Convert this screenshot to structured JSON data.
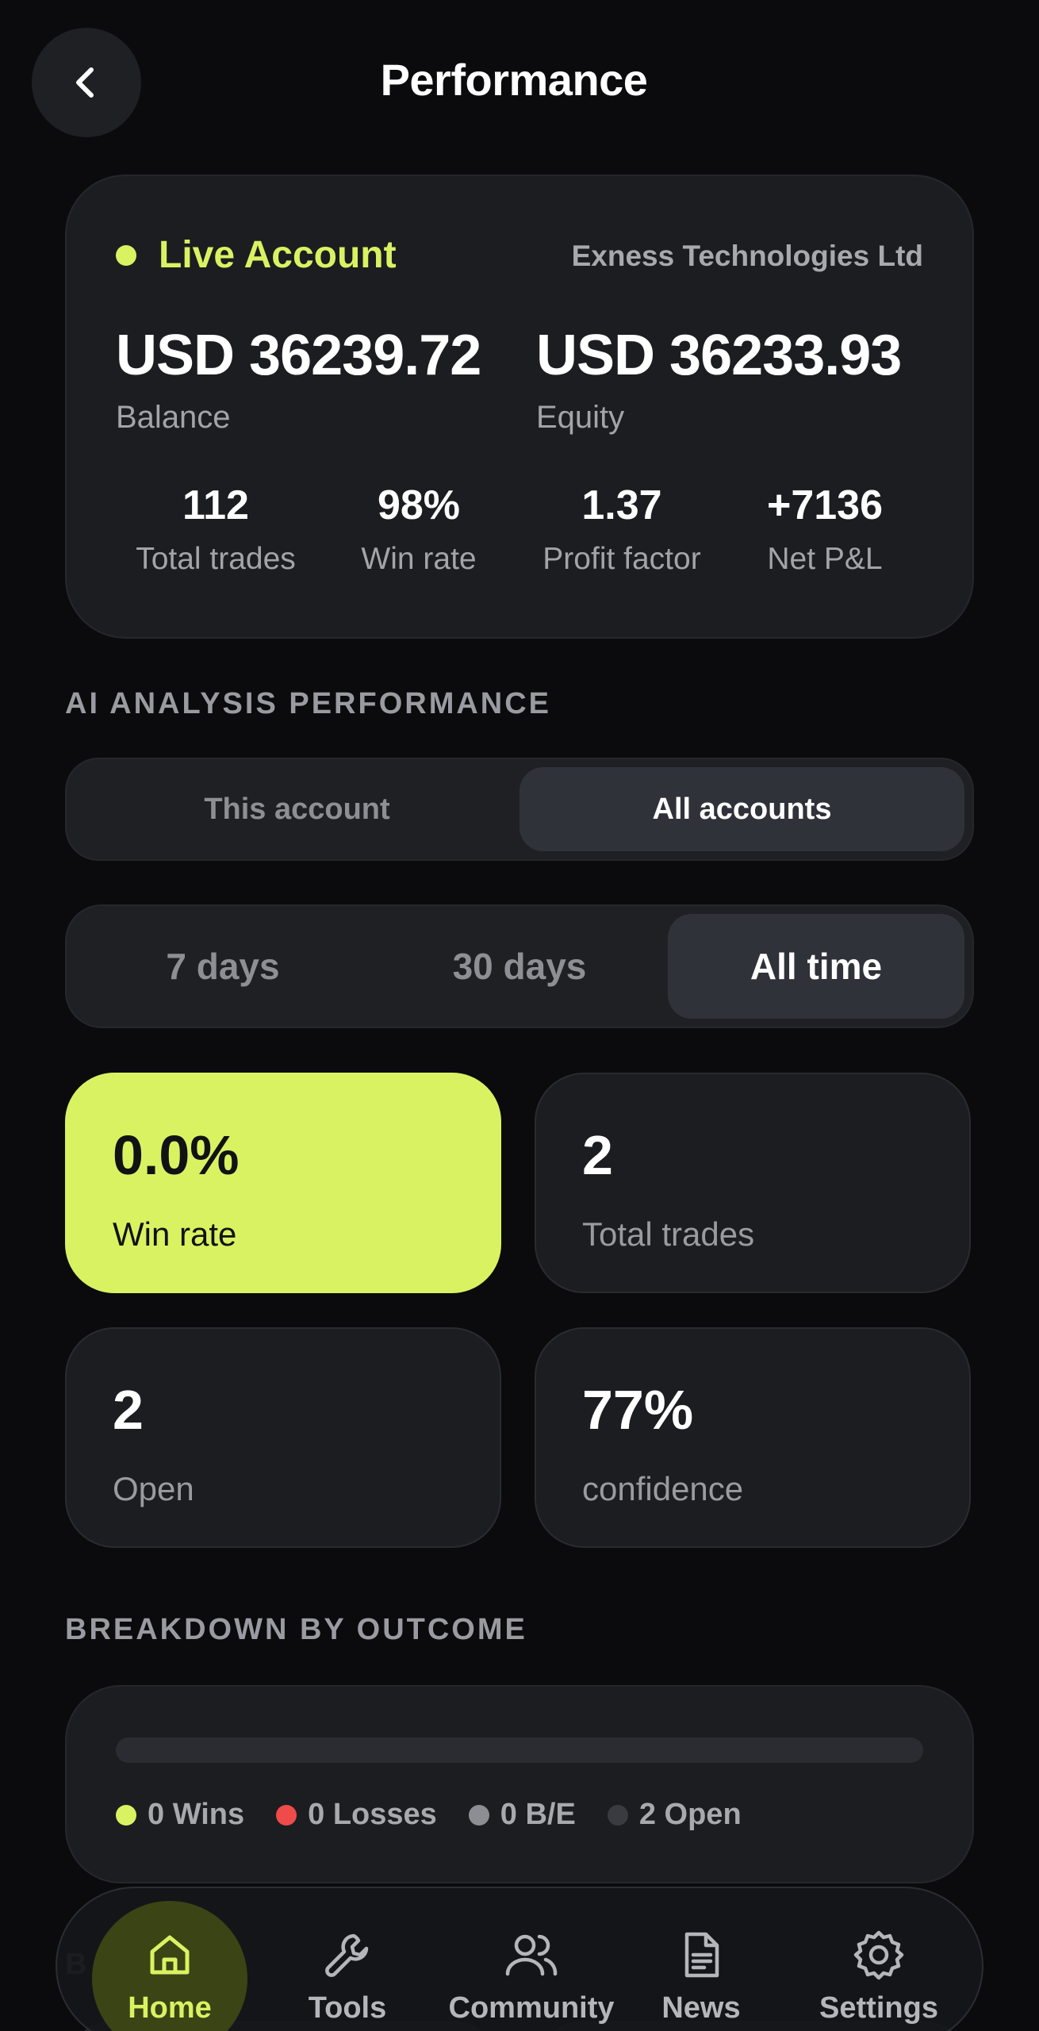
{
  "header": {
    "title": "Performance"
  },
  "account": {
    "status_label": "Live Account",
    "broker": "Exness Technologies Ltd",
    "balance_value": "USD 36239.72",
    "balance_label": "Balance",
    "equity_value": "USD 36233.93",
    "equity_label": "Equity",
    "stats": [
      {
        "value": "112",
        "label": "Total trades"
      },
      {
        "value": "98%",
        "label": "Win rate"
      },
      {
        "value": "1.37",
        "label": "Profit factor"
      },
      {
        "value": "+7136",
        "label": "Net P&L"
      }
    ]
  },
  "ai_section": {
    "title": "AI ANALYSIS PERFORMANCE",
    "scope_tabs": [
      {
        "label": "This account",
        "active": false
      },
      {
        "label": "All accounts",
        "active": true
      }
    ],
    "range_tabs": [
      {
        "label": "7 days",
        "active": false
      },
      {
        "label": "30 days",
        "active": false
      },
      {
        "label": "All time",
        "active": true
      }
    ],
    "metrics": [
      {
        "value": "0.0%",
        "label": "Win rate"
      },
      {
        "value": "2",
        "label": "Total trades"
      },
      {
        "value": "2",
        "label": "Open"
      },
      {
        "value": "77%",
        "label": "confidence"
      }
    ]
  },
  "breakdown": {
    "title": "BREAKDOWN BY OUTCOME",
    "win_fraction": 0,
    "legend": [
      {
        "label": "0 Wins",
        "color": "#d9f262"
      },
      {
        "label": "0 Losses",
        "color": "#ef4b4b"
      },
      {
        "label": "0 B/E",
        "color": "#8d8e93"
      },
      {
        "label": "2 Open",
        "color": "#3a3b40"
      }
    ]
  },
  "next_section_peek": "B",
  "bottom_nav": [
    {
      "label": "Home",
      "icon": "home-icon",
      "active": true
    },
    {
      "label": "Tools",
      "icon": "wrench-icon",
      "active": false
    },
    {
      "label": "Community",
      "icon": "users-icon",
      "active": false
    },
    {
      "label": "News",
      "icon": "document-icon",
      "active": false
    },
    {
      "label": "Settings",
      "icon": "gear-icon",
      "active": false
    }
  ],
  "colors": {
    "accent": "#d9f262",
    "background": "#0b0b0d",
    "card": "#1c1d21"
  }
}
